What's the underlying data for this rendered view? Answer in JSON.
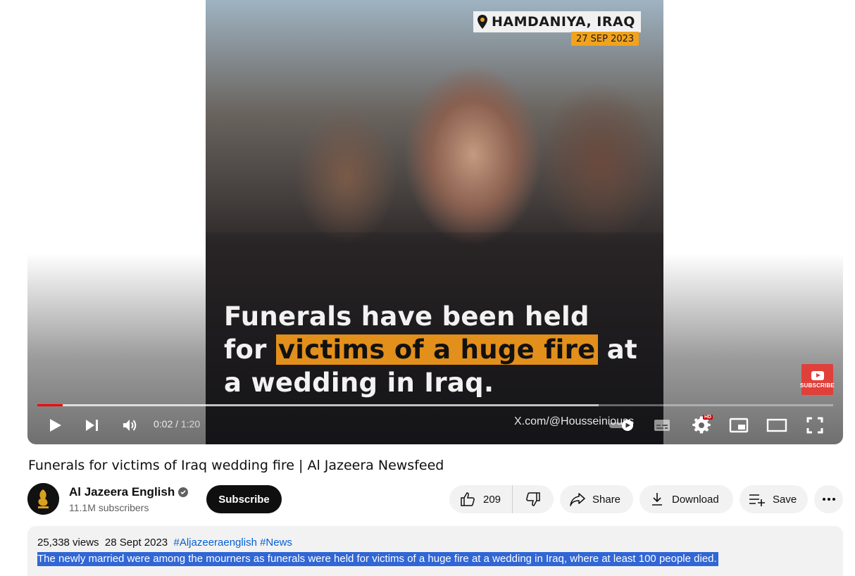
{
  "player": {
    "location": "HAMDANIYA, IRAQ",
    "date": "27 SEP 2023",
    "caption_line1": "Funerals have been held",
    "caption_line2_pre": "for",
    "caption_line2_hl": "victims of a huge fire",
    "caption_line2_post": "at",
    "caption_line3": "a wedding in Iraq.",
    "subscribe_badge": "SUBSCRIBE",
    "watermark": "X.com/@Housseiniouss",
    "time_current": "0:02",
    "time_duration": "1:20",
    "progress": 0.032,
    "buffered": 0.705,
    "hd_badge": "HD",
    "icons": [
      "play-icon",
      "next-icon",
      "volume-icon",
      "autoplay-toggle-icon",
      "captions-icon",
      "settings-icon",
      "miniplayer-icon",
      "theater-icon",
      "fullscreen-icon"
    ]
  },
  "video": {
    "title": "Funerals for victims of Iraq wedding fire | Al Jazeera Newsfeed",
    "channel": "Al Jazeera English",
    "subscribers": "11.1M subscribers",
    "subscribe_label": "Subscribe"
  },
  "actions": {
    "likes": "209",
    "share": "Share",
    "download": "Download",
    "save": "Save"
  },
  "description": {
    "views": "25,338 views",
    "date": "28 Sept 2023",
    "hashtags": "#Aljazeeraenglish #News",
    "text": "The newly married were among the mourners as funerals were held for victims of a huge fire at a wedding in Iraq, where at least 100 people died."
  },
  "colors": {
    "accent_red": "#ff0000",
    "link_blue": "#065fd4",
    "highlight_orange": "#e28f1c",
    "selection_blue": "#3166d5"
  }
}
